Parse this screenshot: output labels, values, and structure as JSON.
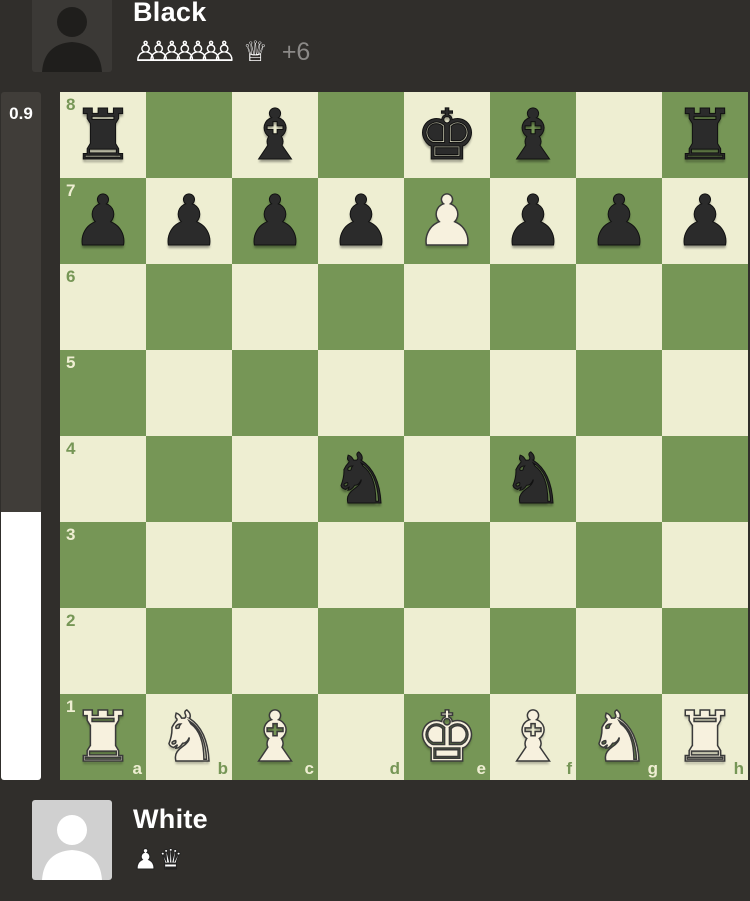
{
  "top_player": {
    "name": "Black",
    "avatar_icon": "user-silhouette-icon",
    "captured": [
      {
        "piece": "pawn",
        "color": "white",
        "count": 7
      },
      {
        "piece": "queen",
        "color": "white",
        "count": 1
      }
    ],
    "captured_pawns_glyph": "♙♙♙♙♙♙♙",
    "captured_queen_glyph": "♕",
    "advantage": "+6"
  },
  "bottom_player": {
    "name": "White",
    "avatar_icon": "user-silhouette-icon",
    "captured": [
      {
        "piece": "pawn",
        "color": "black",
        "count": 1
      },
      {
        "piece": "queen",
        "color": "black",
        "count": 1
      }
    ],
    "captured_pawns_glyph": "♟",
    "captured_queen_glyph": "♛"
  },
  "eval": {
    "label": "0.9",
    "white_fraction": 0.39
  },
  "colors": {
    "light_square": "#eeeed2",
    "dark_square": "#769656",
    "background": "#302e2b"
  },
  "board": {
    "files": [
      "a",
      "b",
      "c",
      "d",
      "e",
      "f",
      "g",
      "h"
    ],
    "ranks": [
      "8",
      "7",
      "6",
      "5",
      "4",
      "3",
      "2",
      "1"
    ],
    "position": [
      [
        "bR",
        "",
        "bB",
        "",
        "bK",
        "bB",
        "",
        "bR"
      ],
      [
        "bP",
        "bP",
        "bP",
        "bP",
        "wP",
        "bP",
        "bP",
        "bP"
      ],
      [
        "",
        "",
        "",
        "",
        "",
        "",
        "",
        ""
      ],
      [
        "",
        "",
        "",
        "",
        "",
        "",
        "",
        ""
      ],
      [
        "",
        "",
        "",
        "bN",
        "",
        "bN",
        "",
        ""
      ],
      [
        "",
        "",
        "",
        "",
        "",
        "",
        "",
        ""
      ],
      [
        "",
        "",
        "",
        "",
        "",
        "",
        "",
        ""
      ],
      [
        "wR",
        "wN",
        "wB",
        "",
        "wK",
        "wB",
        "wN",
        "wR"
      ]
    ]
  }
}
